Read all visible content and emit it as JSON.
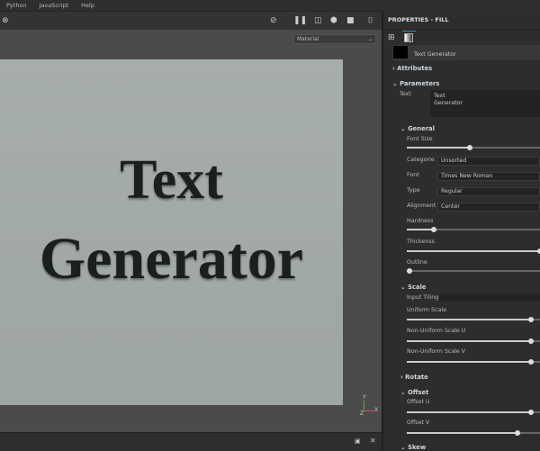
{
  "menu": [
    "Python",
    "JavaScript",
    "Help"
  ],
  "viewport": {
    "material_select": "Material",
    "canvas_text_line1": "Text",
    "canvas_text_line2": "Generator",
    "gizmo": {
      "y": "Y",
      "x": "X",
      "z": "Z"
    }
  },
  "panel": {
    "title": "PROPERTIES - FILL",
    "layer_name": "Text Generator",
    "attributes": "Attributes",
    "parameters": "Parameters",
    "text_label": "Text",
    "text_value_line1": "Text",
    "text_value_line2": "Generator",
    "general": "General",
    "font_size": {
      "label": "Font Size",
      "value": 0.47
    },
    "categorie": {
      "label": "Categorie",
      "value": "Unsorted"
    },
    "font": {
      "label": "Font",
      "value": "Times New Roman"
    },
    "type": {
      "label": "Type",
      "value": "Regular"
    },
    "alignment": {
      "label": "Alignment",
      "value": "Center"
    },
    "hardness": {
      "label": "Hardness",
      "value": 0.2
    },
    "thickness": {
      "label": "Thickenss",
      "value": 1.0
    },
    "outline": {
      "label": "Outline",
      "value": 0.02
    },
    "scale": "Scale",
    "input_tiling": "Input Tiling",
    "uniform_scale": {
      "label": "Uniform Scale",
      "value": 0.93
    },
    "nonuniform_u": {
      "label": "Non-Uniform Scale U",
      "value": 0.93
    },
    "nonuniform_v": {
      "label": "Non-Uniform Scale V",
      "value": 0.93
    },
    "rotate": "Rotate",
    "offset": "Offset",
    "offset_u": {
      "label": "Offset U",
      "value": 0.93
    },
    "offset_v": {
      "label": "Offset V",
      "value": 0.83
    },
    "skew": "Skew"
  }
}
